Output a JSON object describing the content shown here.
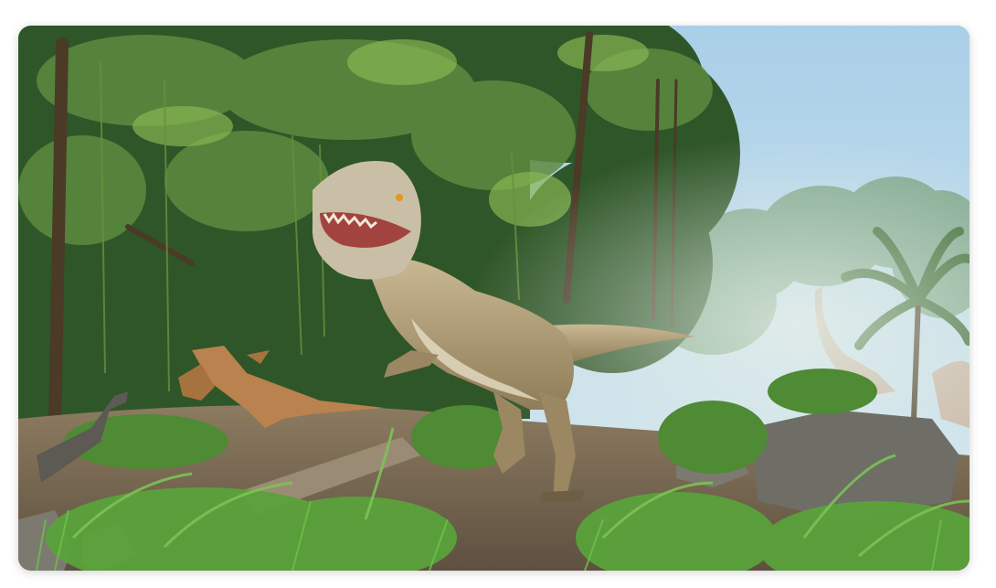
{
  "scene": {
    "subject": "dinosaur-jungle-render",
    "sky_color": "#a9cfe8",
    "foliage_color": "#3f6b35",
    "ground_color": "#7a6a52",
    "dino_color": "#b7a57e"
  }
}
